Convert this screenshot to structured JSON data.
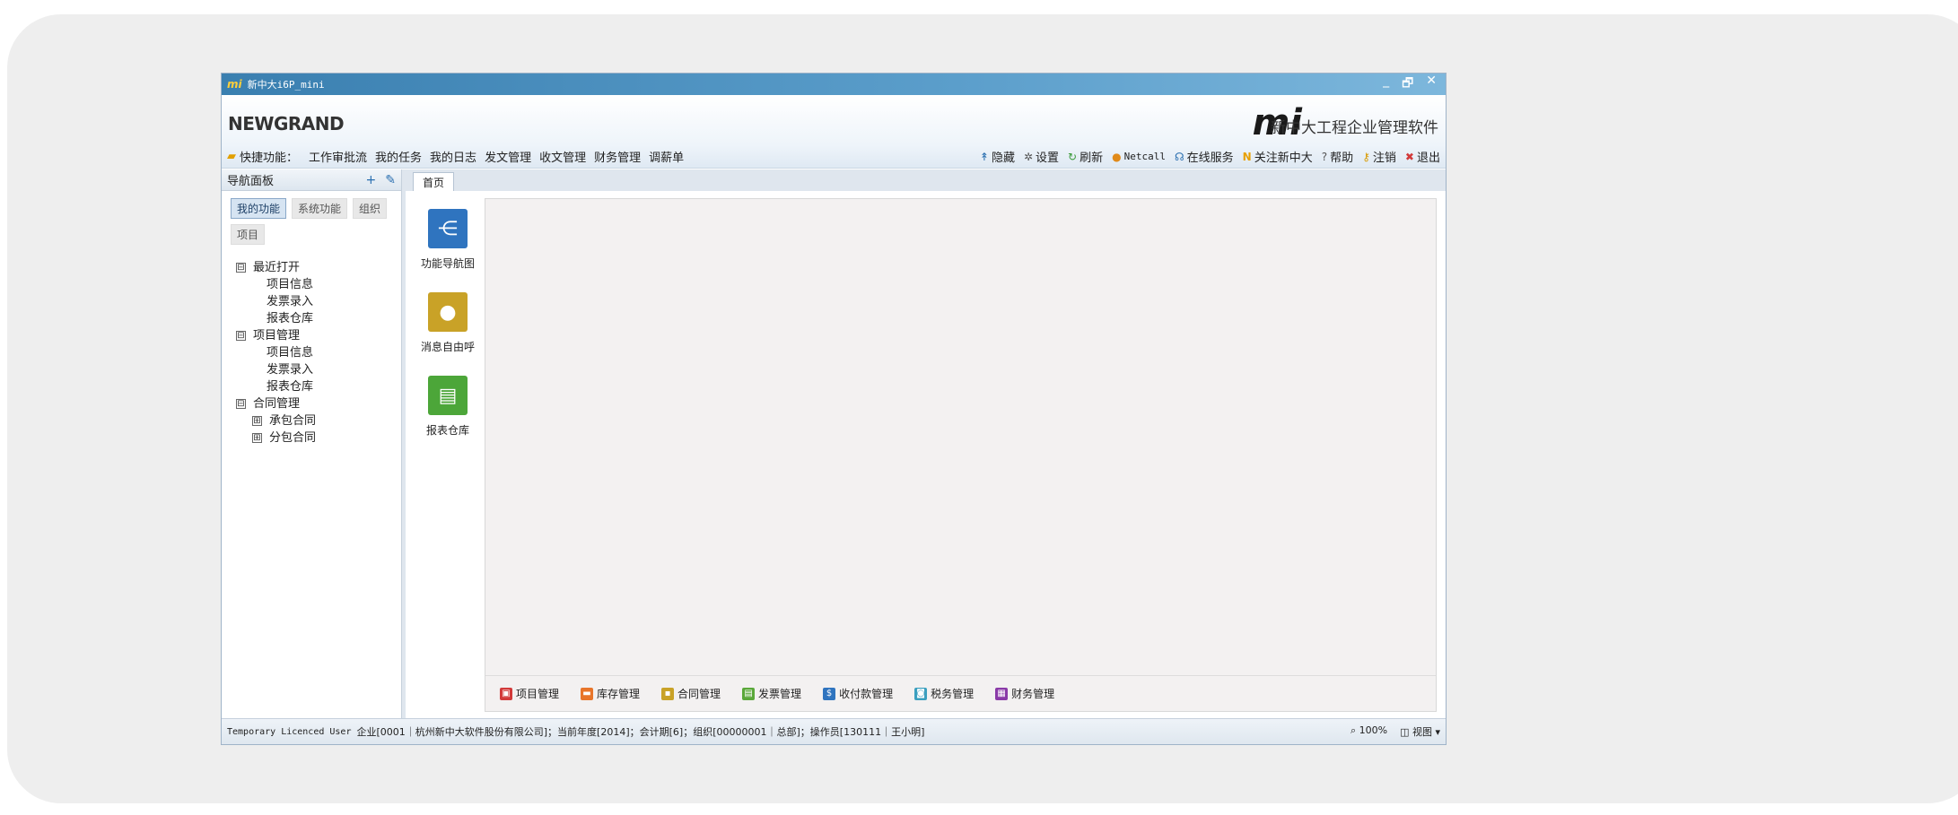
{
  "window": {
    "logo": "mi",
    "title": "新中大i6P_mini",
    "controls": {
      "minimize": "_",
      "restore": "🗗",
      "close": "✕"
    }
  },
  "banner": {
    "brand": "NEWGRAND",
    "logo": "mi",
    "slogan": "新中大工程企业管理软件"
  },
  "toolbar": {
    "quick_label": "快捷功能：",
    "quick_links": [
      "工作审批流",
      "我的任务",
      "我的日志",
      "发文管理",
      "收文管理",
      "财务管理",
      "调薪单"
    ],
    "actions": [
      {
        "label": "隐藏",
        "icon": "↟"
      },
      {
        "label": "设置",
        "icon": "✲"
      },
      {
        "label": "刷新",
        "icon": "↻"
      },
      {
        "label": "Netcall",
        "icon": "●"
      },
      {
        "label": "在线服务",
        "icon": "☊"
      },
      {
        "label": "关注新中大",
        "icon": "N"
      },
      {
        "label": "帮助",
        "icon": "?"
      },
      {
        "label": "注销",
        "icon": "⚷"
      },
      {
        "label": "退出",
        "icon": "✖"
      }
    ]
  },
  "nav": {
    "title": "导航面板",
    "tabs": [
      "我的功能",
      "系统功能",
      "组织",
      "项目"
    ],
    "tree": [
      {
        "label": "最近打开",
        "toggle": "⊟",
        "children": [
          "项目信息",
          "发票录入",
          "报表仓库"
        ]
      },
      {
        "label": "项目管理",
        "toggle": "⊟",
        "children": [
          "项目信息",
          "发票录入",
          "报表仓库"
        ]
      },
      {
        "label": "合同管理",
        "toggle": "⊟",
        "subgroups": [
          {
            "label": "承包合同",
            "toggle": "⊞"
          },
          {
            "label": "分包合同",
            "toggle": "⊞"
          }
        ]
      }
    ]
  },
  "content": {
    "tab": "首页",
    "functions": [
      {
        "label": "功能导航图",
        "color": "#2f74bf"
      },
      {
        "label": "消息自由呼",
        "color": "#c9a227"
      },
      {
        "label": "报表仓库",
        "color": "#4ca639"
      }
    ],
    "bottom_links": [
      {
        "label": "项目管理",
        "color": "#d23a3a"
      },
      {
        "label": "库存管理",
        "color": "#e8752a"
      },
      {
        "label": "合同管理",
        "color": "#c9a227"
      },
      {
        "label": "发票管理",
        "color": "#5aa83a"
      },
      {
        "label": "收付款管理",
        "color": "#2f74bf"
      },
      {
        "label": "税务管理",
        "color": "#3a9fbf"
      },
      {
        "label": "财务管理",
        "color": "#8a3aa8"
      }
    ]
  },
  "status": {
    "license": "Temporary Licenced User",
    "info": "企业[0001｜杭州新中大软件股份有限公司]；当前年度[2014]；会计期[6]；组织[00000001｜总部]；操作员[130111｜王小明]",
    "zoom": "100%",
    "view": "视图"
  }
}
